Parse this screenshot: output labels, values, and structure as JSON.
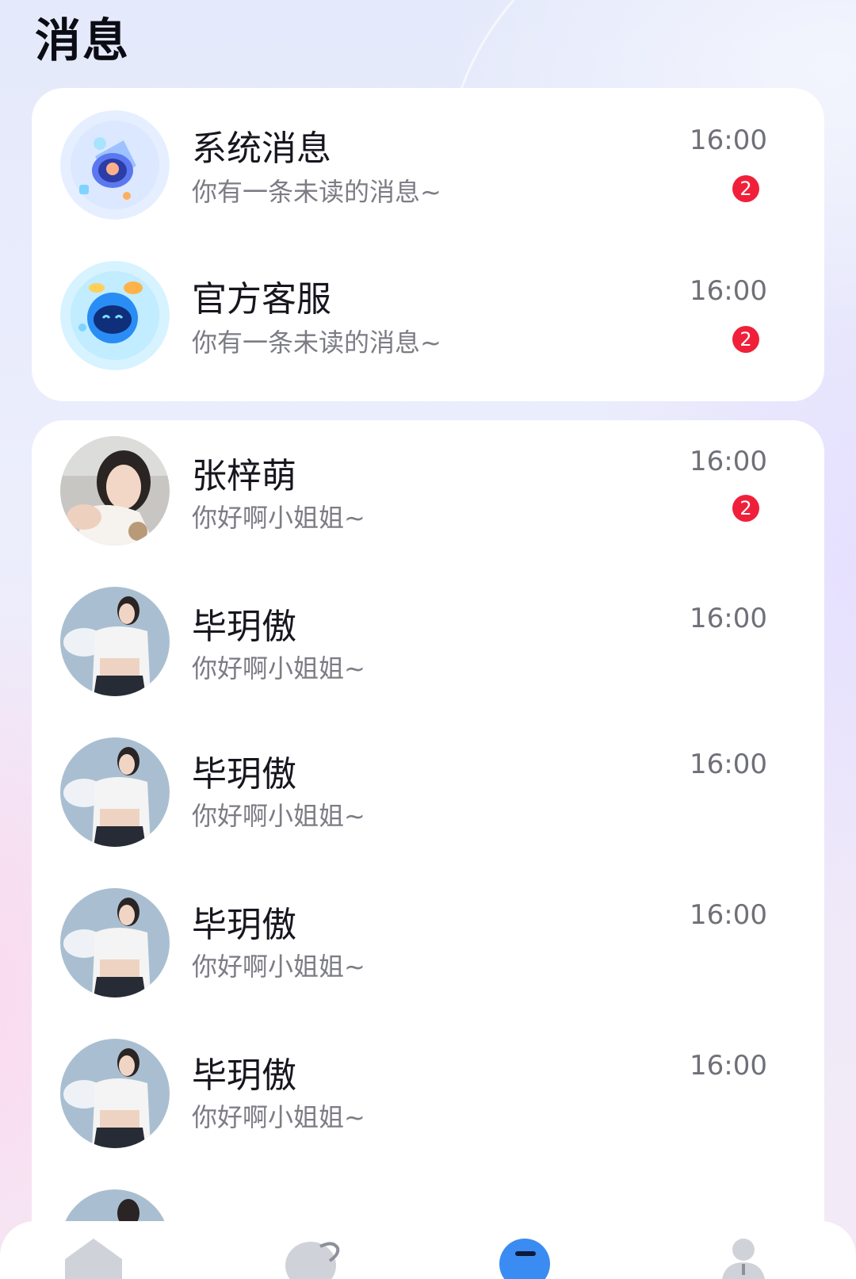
{
  "header": {
    "title": "消息"
  },
  "top_list": [
    {
      "name": "系统消息",
      "preview": "你有一条未读的消息~",
      "time": "16:00",
      "badge": "2",
      "icon": "bell-icon"
    },
    {
      "name": "官方客服",
      "preview": "你有一条未读的消息~",
      "time": "16:00",
      "badge": "2",
      "icon": "robot-icon"
    }
  ],
  "chats": [
    {
      "name": "张梓萌",
      "preview": "你好啊小姐姐~",
      "time": "16:00",
      "badge": "2"
    },
    {
      "name": "毕玥傲",
      "preview": "你好啊小姐姐~",
      "time": "16:00"
    },
    {
      "name": "毕玥傲",
      "preview": "你好啊小姐姐~",
      "time": "16:00"
    },
    {
      "name": "毕玥傲",
      "preview": "你好啊小姐姐~",
      "time": "16:00"
    },
    {
      "name": "毕玥傲",
      "preview": "你好啊小姐姐~",
      "time": "16:00"
    }
  ],
  "tabs": [
    {
      "icon": "home-icon",
      "active": false
    },
    {
      "icon": "discover-icon",
      "active": false
    },
    {
      "icon": "message-icon",
      "active": true
    },
    {
      "icon": "profile-icon",
      "active": false
    }
  ],
  "colors": {
    "accent": "#3b8cf2",
    "badge": "#f0203a",
    "text": "#16161e",
    "muted": "#7c7c85"
  }
}
